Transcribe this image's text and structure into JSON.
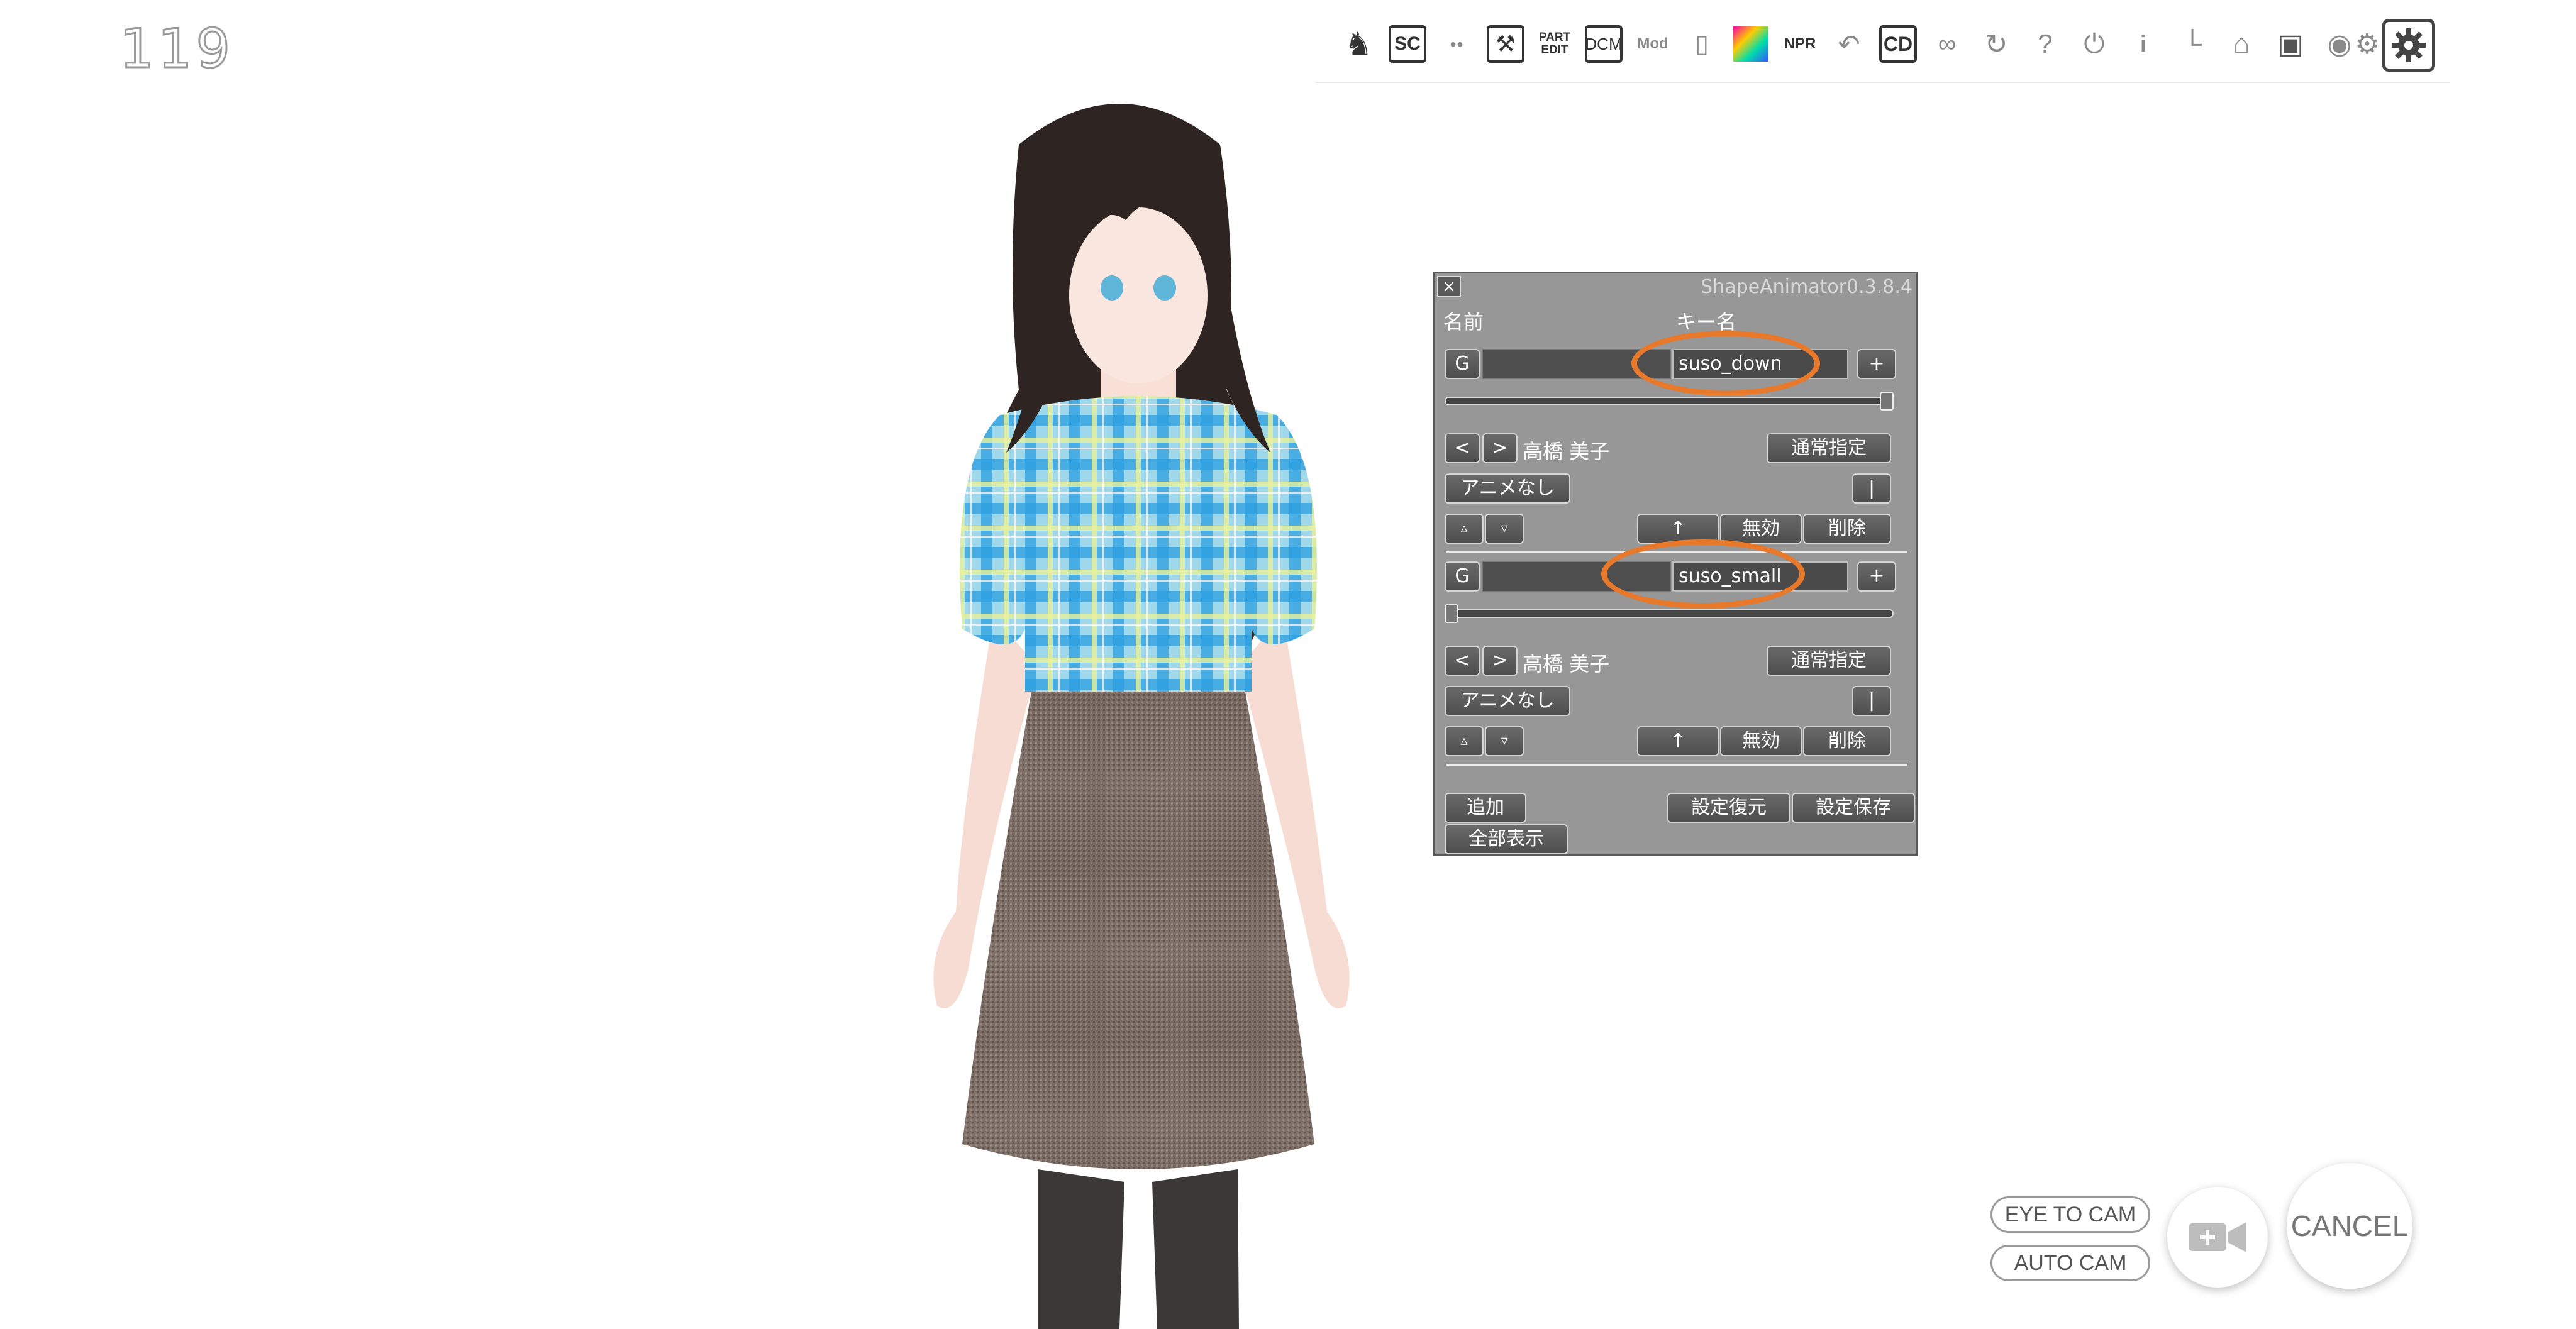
{
  "fps_counter": "119",
  "toolbar": {
    "icons": [
      {
        "name": "pose-icon",
        "glyph": "♞"
      },
      {
        "name": "sc-icon",
        "glyph": "SC"
      },
      {
        "name": "eye-mask-icon",
        "glyph": "●●"
      },
      {
        "name": "wrench-icon",
        "glyph": "⚒"
      },
      {
        "name": "part-edit-icon",
        "glyph": "PART EDIT"
      },
      {
        "name": "dcm-icon",
        "glyph": "DCM"
      },
      {
        "name": "mod-icon",
        "glyph": "Mod"
      },
      {
        "name": "slot-icon",
        "glyph": "▯"
      },
      {
        "name": "color-palette-icon",
        "glyph": ""
      },
      {
        "name": "npr-icon",
        "glyph": "NPR"
      },
      {
        "name": "undo-icon",
        "glyph": "↶"
      },
      {
        "name": "cd-icon",
        "glyph": "CD"
      },
      {
        "name": "glasses-icon",
        "glyph": "∞"
      },
      {
        "name": "refresh-icon",
        "glyph": "↻"
      },
      {
        "name": "help-icon",
        "glyph": "?"
      },
      {
        "name": "power-icon",
        "glyph": "⏻"
      },
      {
        "name": "info-icon",
        "glyph": "i"
      },
      {
        "name": "graph-icon",
        "glyph": "└"
      },
      {
        "name": "basket-icon",
        "glyph": "⌂"
      },
      {
        "name": "phone-camera-icon",
        "glyph": "▣"
      },
      {
        "name": "camera-icon",
        "glyph": "◉"
      },
      {
        "name": "gears-icon",
        "glyph": "⚙"
      }
    ],
    "settings_icon": "gear-icon"
  },
  "panel": {
    "title": "ShapeAnimator0.3.8.4",
    "close_label": "×",
    "header_name": "名前",
    "header_key": "キー名",
    "entries": [
      {
        "g_label": "G",
        "key_name": "suso_down",
        "plus_label": "+",
        "slider_value": 1.0,
        "prev_label": "<",
        "next_label": ">",
        "maid_name": "高橋 美子",
        "mode_label": "通常指定",
        "anime_label": "アニメなし",
        "bar_label": "|",
        "up_small": "▵",
        "down_small": "▿",
        "up_label": "↑",
        "disable_label": "無効",
        "delete_label": "削除"
      },
      {
        "g_label": "G",
        "key_name": "suso_small",
        "plus_label": "+",
        "slider_value": 0.0,
        "prev_label": "<",
        "next_label": ">",
        "maid_name": "高橋 美子",
        "mode_label": "通常指定",
        "anime_label": "アニメなし",
        "bar_label": "|",
        "up_small": "▵",
        "down_small": "▿",
        "up_label": "↑",
        "disable_label": "無効",
        "delete_label": "削除"
      }
    ],
    "add_label": "追加",
    "show_all_label": "全部表示",
    "restore_label": "設定復元",
    "save_label": "設定保存"
  },
  "bottom": {
    "eye_to_cam": "EYE TO CAM",
    "auto_cam": "AUTO CAM",
    "cancel": "CANCEL",
    "camera_add_icon": "video-camera-plus-icon"
  },
  "colors": {
    "panel_bg": "#979797",
    "annotation": "#e8782a"
  }
}
